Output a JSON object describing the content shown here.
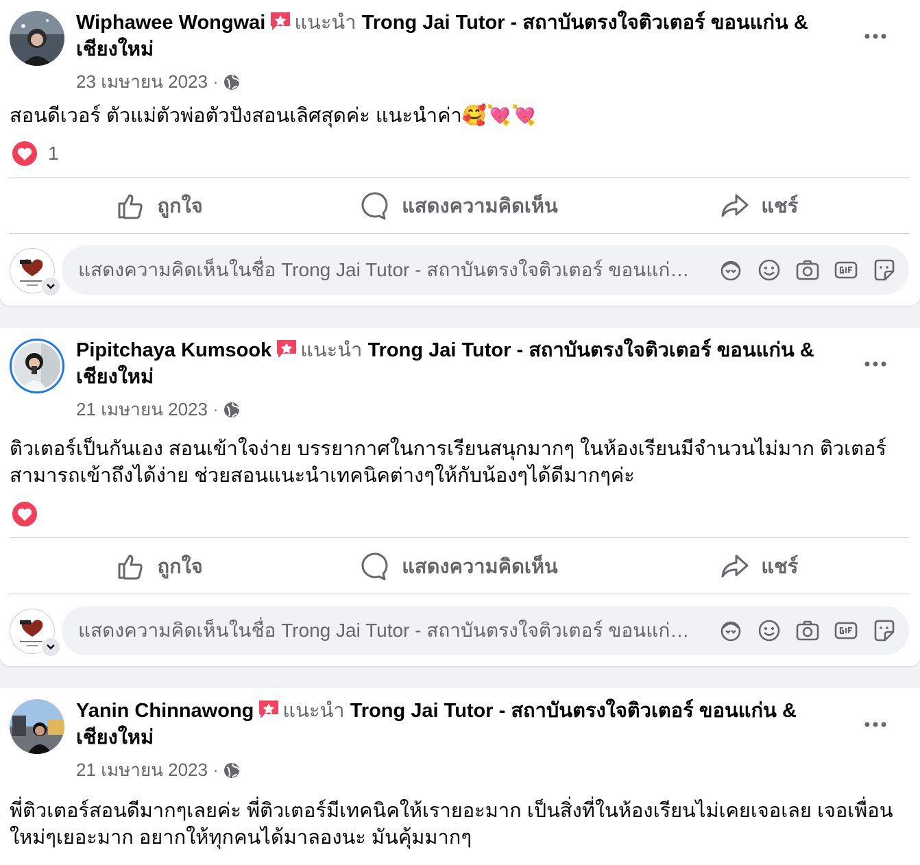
{
  "common": {
    "recommend_word": "แนะนำ",
    "page_name": "Trong Jai Tutor - สถาบันตรงใจติวเตอร์ ขอนแก่น & เชียงใหม่",
    "like_label": "ถูกใจ",
    "comment_label": "แสดงความคิดเห็น",
    "share_label": "แชร์",
    "composer_placeholder": "แสดงความคิดเห็นในชื่อ Trong Jai Tutor - สถาบันตรงใจติวเตอร์ ขอนแก่น & เชียงใหม่",
    "separator": "·",
    "colors": {
      "heart": "#f33e58",
      "recommend_badge": "#f3425f",
      "secondary_text": "#65676b",
      "ring": "#1877f2"
    }
  },
  "posts": [
    {
      "author": "Wiphawee Wongwai",
      "date": "23 เมษายน 2023",
      "text": "สอนดีเวอร์ ตัวแม่ตัวพ่อตัวปังสอนเลิศสุดค่ะ แนะนำค่า🥰💘💘",
      "reaction_count": "1"
    },
    {
      "author": "Pipitchaya Kumsook",
      "date": "21 เมษายน 2023",
      "text": "ติวเตอร์เป็นกันเอง สอนเข้าใจง่าย บรรยากาศในการเรียนสนุกมากๆ ในห้องเรียนมีจำนวนไม่มาก ติวเตอร์\nสามารถเข้าถึงได้ง่าย ช่วยสอนแนะนำเทคนิคต่างๆให้กับน้องๆได้ดีมากๆค่ะ",
      "reaction_count": ""
    },
    {
      "author": "Yanin Chinnawong",
      "date": "21 เมษายน 2023",
      "text": "พี่ติวเตอร์สอนดีมากๆเลยค่ะ พี่ติวเตอร์มีเทคนิคให้เรายอะมาก เป็นสิ่งที่ในห้องเรียนไม่เคยเจอเลย เจอเพื่อน\nใหม่ๆเยอะมาก อยากให้ทุกคนได้มาลองนะ มันคุ้มมากๆ"
    }
  ]
}
